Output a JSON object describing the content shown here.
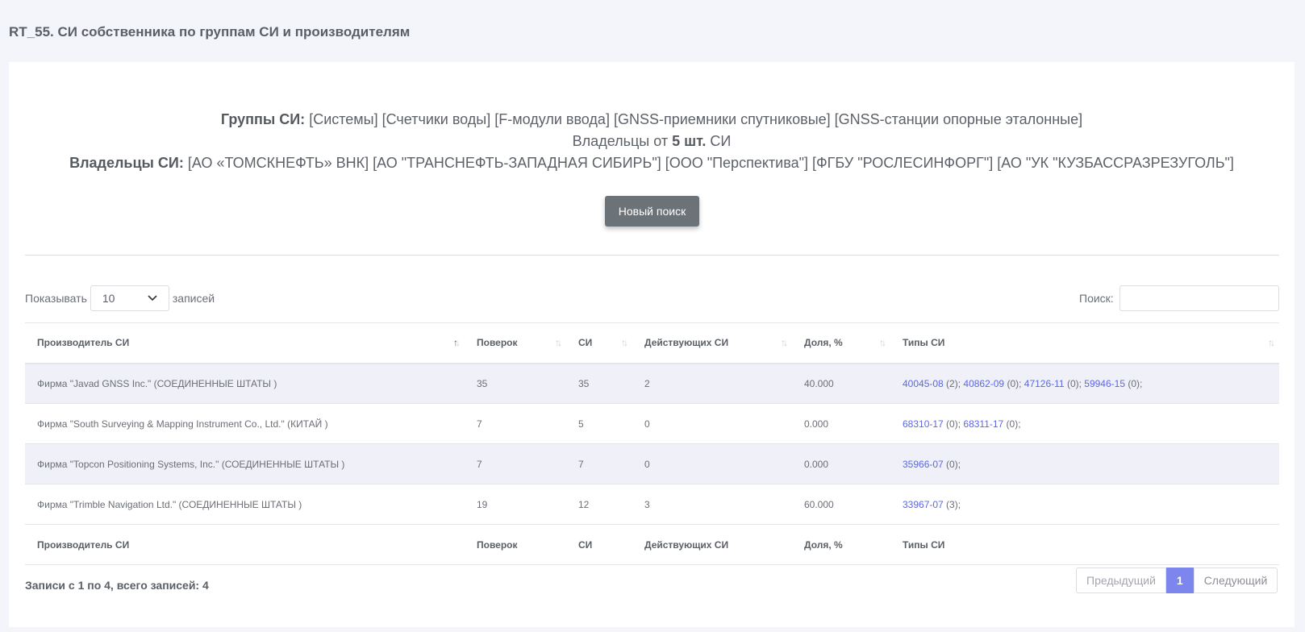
{
  "page": {
    "title": "RT_55. СИ собственника по группам СИ и производителям"
  },
  "summary": {
    "groups_label": "Группы СИ:",
    "groups_value": "[Системы] [Счетчики воды] [F-модули ввода] [GNSS-приемники спутниковые] [GNSS-станции опорные эталонные]",
    "owners_from_prefix": "Владельцы от",
    "owners_from_count": "5 шт.",
    "owners_from_suffix": "СИ",
    "owners_label": "Владельцы СИ:",
    "owners_value": "[АО «ТОМСКНЕФТЬ» ВНК] [АО \"ТРАНСНЕФТЬ-ЗАПАДНАЯ СИБИРЬ\"] [ООО \"Перспектива\"] [ФГБУ \"РОСЛЕСИНФОРГ\"] [АО \"УК \"КУЗБАССРАЗРЕЗУГОЛЬ\"]",
    "new_search_label": "Новый поиск"
  },
  "controls": {
    "show_label": "Показывать",
    "page_size": "10",
    "records_label": "записей",
    "search_label": "Поиск:",
    "search_value": ""
  },
  "table": {
    "headers": [
      "Производитель СИ",
      "Поверок",
      "СИ",
      "Действующих СИ",
      "Доля, %",
      "Типы СИ"
    ],
    "rows": [
      {
        "manufacturer": "Фирма \"Javad GNSS Inc.\" (СОЕДИНЕННЫЕ ШТАТЫ )",
        "verifications": "35",
        "si": "35",
        "active": "2",
        "share": "40.000",
        "types": [
          {
            "code": "40045-08",
            "count": " (2); "
          },
          {
            "code": "40862-09",
            "count": " (0); "
          },
          {
            "code": "47126-11",
            "count": " (0); "
          },
          {
            "code": "59946-15",
            "count": " (0);"
          }
        ]
      },
      {
        "manufacturer": "Фирма \"South Surveying & Mapping Instrument Co., Ltd.\" (КИТАЙ )",
        "verifications": "7",
        "si": "5",
        "active": "0",
        "share": "0.000",
        "types": [
          {
            "code": "68310-17",
            "count": " (0); "
          },
          {
            "code": "68311-17",
            "count": " (0);"
          }
        ]
      },
      {
        "manufacturer": "Фирма \"Topcon Positioning Systems, Inc.\" (СОЕДИНЕННЫЕ ШТАТЫ )",
        "verifications": "7",
        "si": "7",
        "active": "0",
        "share": "0.000",
        "types": [
          {
            "code": "35966-07",
            "count": " (0);"
          }
        ]
      },
      {
        "manufacturer": "Фирма \"Trimble Navigation Ltd.\" (СОЕДИНЕННЫЕ ШТАТЫ )",
        "verifications": "19",
        "si": "12",
        "active": "3",
        "share": "60.000",
        "types": [
          {
            "code": "33967-07",
            "count": " (3);"
          }
        ]
      }
    ]
  },
  "footer": {
    "info": "Записи с 1 по 4, всего записей: 4",
    "prev_label": "Предыдущий",
    "current_page": "1",
    "next_label": "Следующий"
  }
}
